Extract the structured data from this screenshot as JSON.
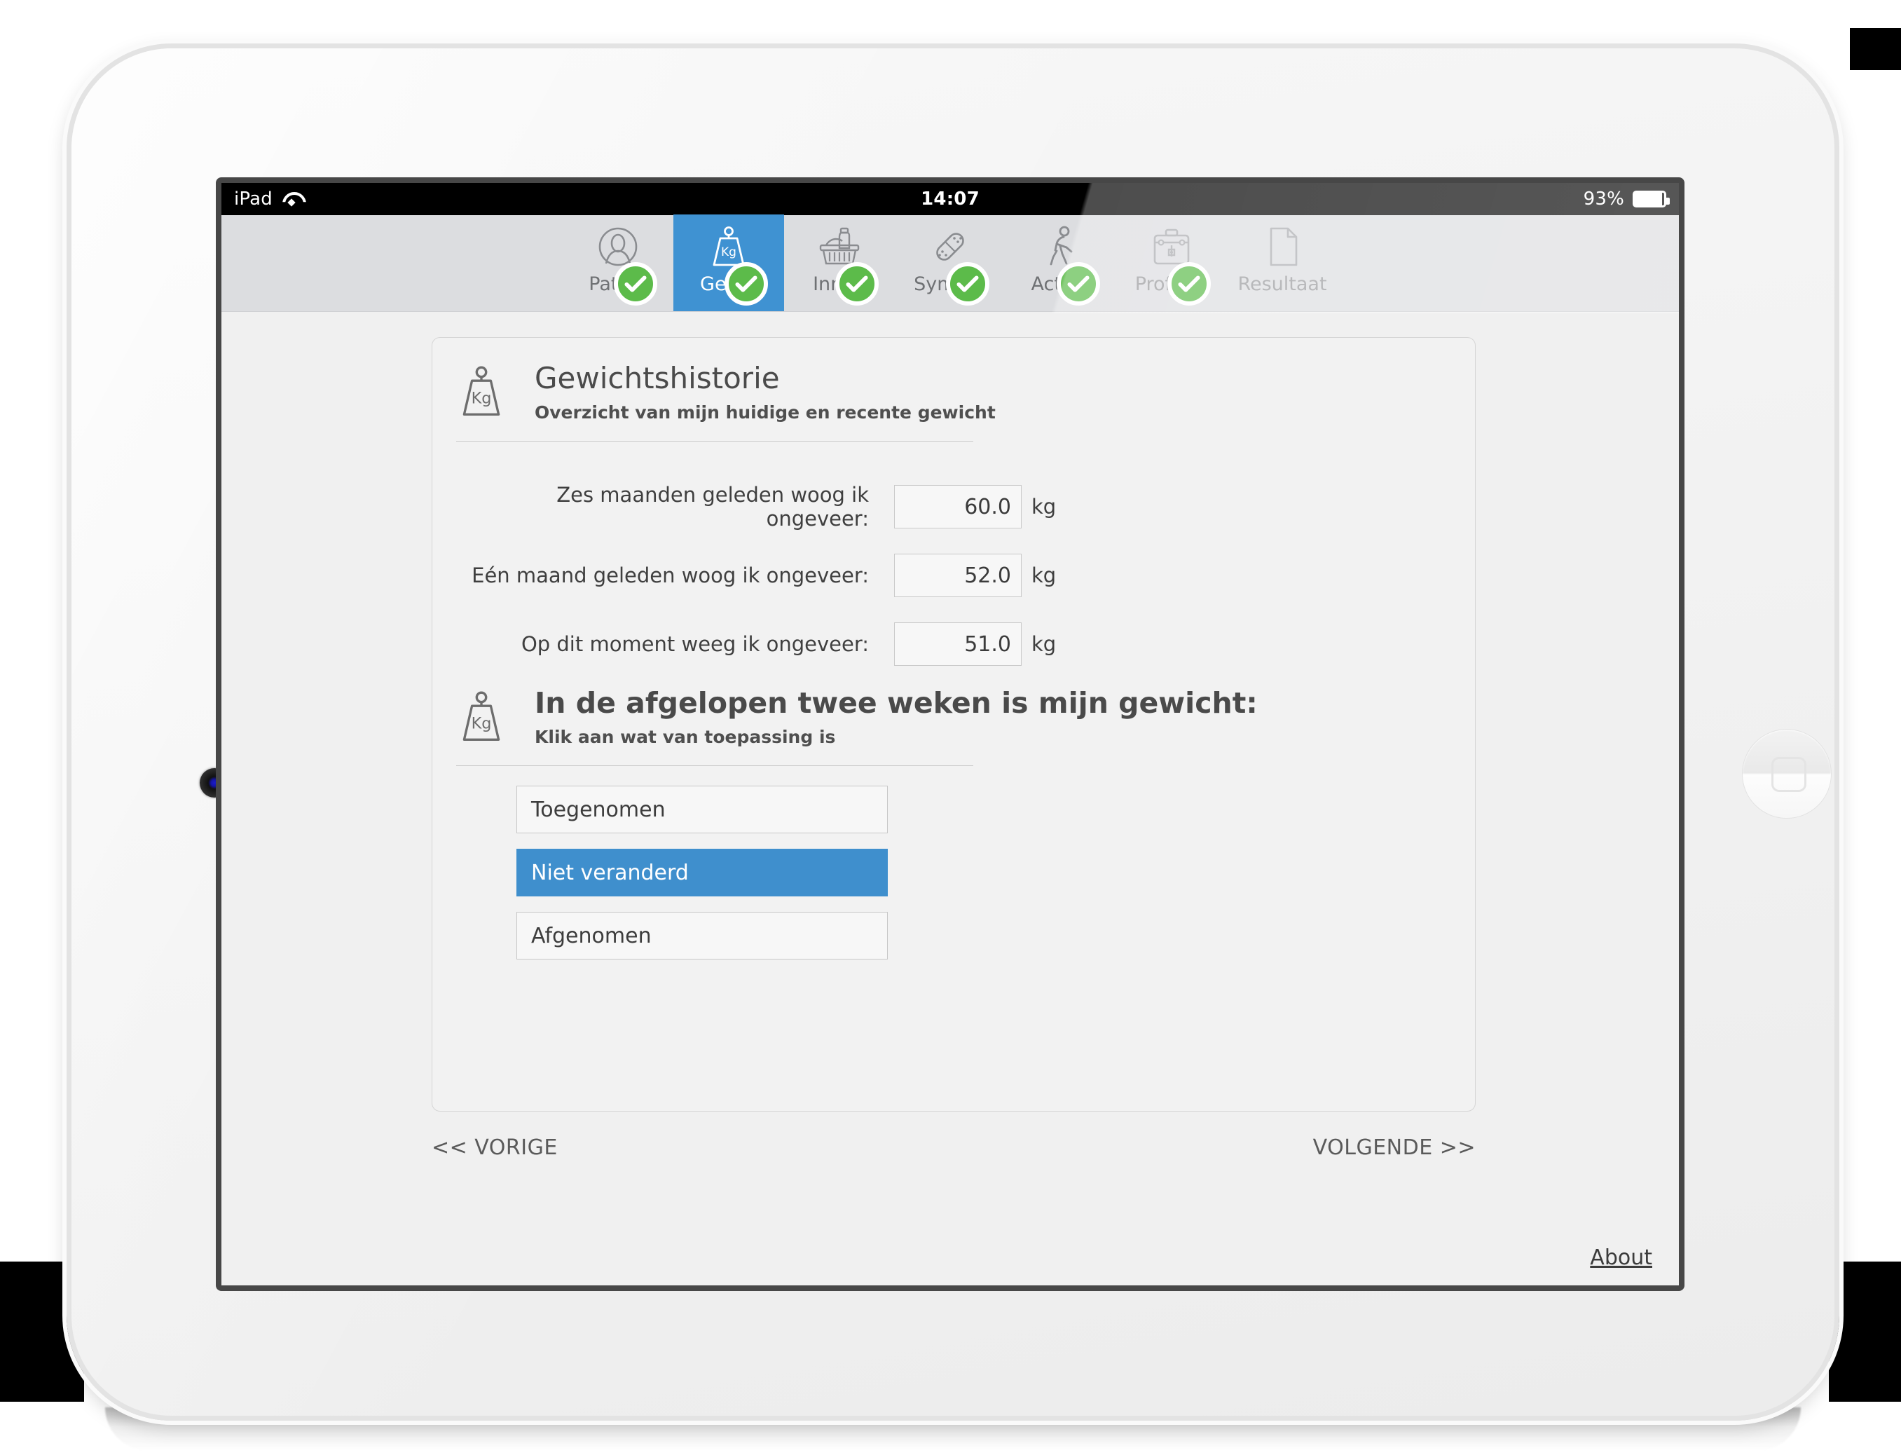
{
  "device": {
    "name": "iPad",
    "camera_icon": "camera-icon",
    "home_button_icon": "home-button-icon"
  },
  "status_bar": {
    "carrier": "iPad",
    "wifi_icon": "wifi-icon",
    "time": "14:07",
    "battery_percent": "93%",
    "battery_icon": "battery-icon"
  },
  "tabs": [
    {
      "label": "Patiën",
      "full_label": "Patiënt",
      "icon": "person-icon",
      "completed": true,
      "active": false,
      "dim": false
    },
    {
      "label": "Gewic",
      "full_label": "Gewicht",
      "icon": "weight-kg-icon",
      "completed": true,
      "active": true,
      "dim": false
    },
    {
      "label": "Innan",
      "full_label": "Inname",
      "icon": "basket-icon",
      "completed": true,
      "active": false,
      "dim": false
    },
    {
      "label": "Sympto",
      "full_label": "Symptomen",
      "icon": "bandage-icon",
      "completed": true,
      "active": false,
      "dim": false
    },
    {
      "label": "Activit",
      "full_label": "Activiteit",
      "icon": "walking-icon",
      "completed": true,
      "active": false,
      "dim": false
    },
    {
      "label": "Professi",
      "full_label": "Professional",
      "icon": "medkit-icon",
      "completed": true,
      "active": false,
      "dim": true
    },
    {
      "label": "Resultaat",
      "full_label": "Resultaat",
      "icon": "document-icon",
      "completed": false,
      "active": false,
      "dim": true
    }
  ],
  "card": {
    "history_section": {
      "icon": "weight-kg-icon",
      "title": "Gewichtshistorie",
      "subtitle": "Overzicht van mijn huidige en recente gewicht"
    },
    "weight_rows": [
      {
        "label": "Zes maanden geleden woog ik ongeveer:",
        "value": "60.0",
        "unit": "kg"
      },
      {
        "label": "Eén maand geleden woog ik ongeveer:",
        "value": "52.0",
        "unit": "kg"
      },
      {
        "label": "Op dit moment weeg ik ongeveer:",
        "value": "51.0",
        "unit": "kg"
      }
    ],
    "change_section": {
      "icon": "weight-kg-icon",
      "title": "In de afgelopen twee weken is mijn gewicht:",
      "subtitle": "Klik aan wat van toepassing is"
    },
    "options": [
      {
        "label": "Toegenomen",
        "selected": false
      },
      {
        "label": "Niet veranderd",
        "selected": true
      },
      {
        "label": "Afgenomen",
        "selected": false
      }
    ]
  },
  "navigation": {
    "previous": "<< VORIGE",
    "next": "VOLGENDE >>"
  },
  "footer": {
    "about": "About"
  },
  "colors": {
    "accent_blue": "#3f8fcd",
    "tab_active_blue": "#3f92d2",
    "check_green": "#5cbb4a",
    "tabbar_gray": "#dcdde0",
    "content_gray": "#f0f0f0"
  }
}
